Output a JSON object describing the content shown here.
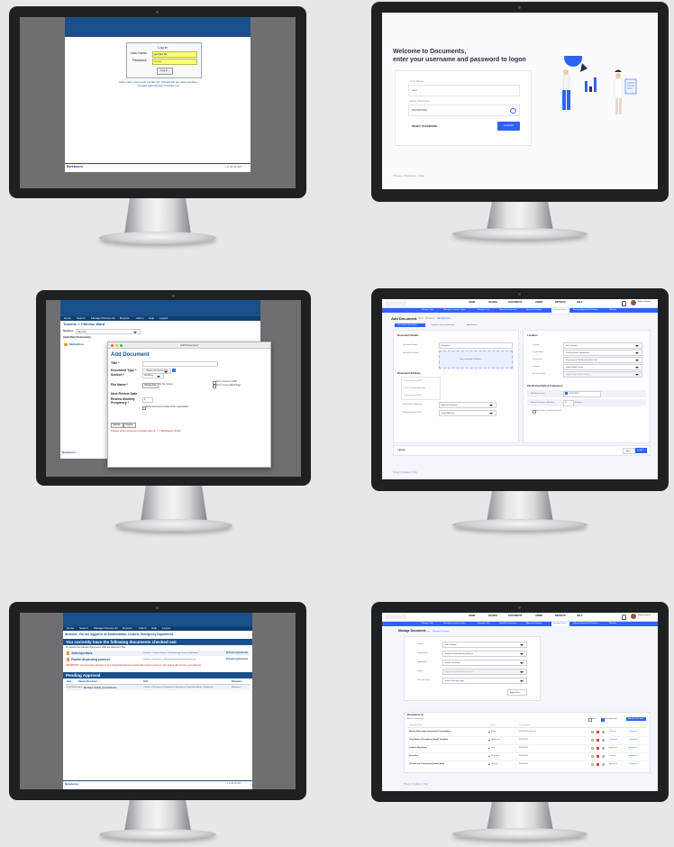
{
  "classic_login": {
    "heading": "Log in",
    "username_label": "User Name:",
    "username_value": "georgie.bb",
    "password_label": "Password:",
    "password_value": "••••••••",
    "login_button": "Log in",
    "hint": "Note: User name must contain '@'. Passwords are case sensitive. Contact administrator if locked out.",
    "footer_brand": "Barebones",
    "footer_right": "v 6.46.32.007"
  },
  "modern_login": {
    "welcome_line1": "Welcome to Documents,",
    "welcome_line2": "enter your username and password to logon",
    "username_label": "User Name",
    "username_value": "user",
    "password_label": "Enter Password",
    "password_value": "PASSWORD",
    "reset_button": "RESET PASSWORD",
    "logon_button": "LOGON",
    "footer": "Privacy | Disclaimer | Help"
  },
  "classic_add": {
    "nav": [
      "Home",
      "Search",
      "Manage Documents",
      "Reports",
      "Admin",
      "Help",
      "Logout"
    ],
    "breadcrumb": "Tumeric > Chinese Ward",
    "section_label": "Section:",
    "section_value": "Section",
    "add_new_label": "[Add New Document]",
    "list_item": "Medication",
    "dialog_title": "Add Document",
    "dialog_heading": "Add Document",
    "title_label": "Title *",
    "doctype_label": "Document Type *",
    "doctype_value": "-- Select document type --",
    "section_field_label": "Section *",
    "section_field_value": "Medicine",
    "file_label": "File Name *",
    "file_button": "Choose File",
    "file_status": "No file chosen",
    "convert_pdf": "Don't convert to PDF",
    "convert_word": "Don't convert Word Tags",
    "next_review_label": "Next Review Date",
    "review_freq_label": "Review Monthly Frequency *",
    "review_freq_value": "6",
    "private_label": "Make document private within organisation",
    "submit_button": "Submit",
    "cancel_button": "Cancel",
    "required_note": "Please enter document details above. * = Mandatory fields.",
    "footer_brand": "Barebones"
  },
  "modern_add": {
    "nav": [
      "HOME",
      "SEARCH",
      "DOCUMENTS",
      "ADMIN",
      "REPORTS",
      "HELP"
    ],
    "user_name": "Ashlyn Barnes",
    "subnav": [
      "Manage Tags",
      "Manage Document Types",
      "Manage Links",
      "Update Permissions",
      "Approval Settings",
      "Manage Roles",
      "Manage Approval Workflows",
      "Modules"
    ],
    "title": "Add Document",
    "breadcrumb": [
      "Home",
      "Document",
      "Add Document"
    ],
    "tabs": [
      "Document Information",
      "Supplementary Information",
      "Applications"
    ],
    "details_heading": "Document Details",
    "doc_name_label": "Document Name",
    "doc_name_value": "Example",
    "upload_label": "Upload Document",
    "drop_text": "Drag and drop or Browse",
    "settings_heading": "Document Settings",
    "settings_options": [
      "Don't convert to PDF",
      "Never Include Watermark",
      "Document is Private"
    ],
    "who_reviews_label": "Select Who to Approve",
    "who_reviews_value": "Approval Required",
    "approval_label": "Select Document Rule",
    "approval_value": "Single Approval",
    "location_heading": "Location",
    "location_fields": [
      {
        "label": "Country",
        "value": "New Zealand"
      },
      {
        "label": "Organisation",
        "value": "Primary Health Organisation"
      },
      {
        "label": "Department",
        "value": "Department of Health and Social Care"
      },
      {
        "label": "Location",
        "value": "Digital Health Centre"
      },
      {
        "label": "Document Type",
        "value": "Digital Health Health Clinical"
      }
    ],
    "review_heading": "Set Review Date & Frequency",
    "review_date_label": "Set Review Date",
    "review_date_value": "21/02/2023",
    "review_freq_label": "Review Frequency (Months)",
    "review_freq_value": "12",
    "review_freq_unit": "Monthly",
    "retain_label": "Don't Make Compulsory Read",
    "cancel_button": "CANCEL",
    "back_button": "BACK",
    "submit_button": "SUBMIT",
    "footer": "Privacy | Disclaimer | Help"
  },
  "classic_manage": {
    "nav": [
      "Home",
      "Search",
      "Manage Documents",
      "Reports",
      "Admin",
      "Help",
      "Logout"
    ],
    "welcome": "Welcome. You are logged in as Administrator, Lecturer, Emergency Department.",
    "checked_out_heading": "You currently have the following documents checked out:",
    "checked_out_intro": "To access the relevant documents click the document title.",
    "checked_out_items": [
      {
        "name": "Joint Injections",
        "location": "Lecturer > Chinese Ward > Chemotherapy Infusion Information",
        "action": "[Check-in] [Cancel]"
      },
      {
        "name": "Parallel dispensing protocol",
        "location": "Lecturer > Pharmacy > Drug Dispensing Infusions/protocols",
        "action": "[Check-in] [Cancel]"
      }
    ],
    "important_note": "IMPORTANT: You must save changes to your local draft documents during the check-in process. Just saving will not save your changes.",
    "pending_heading": "Pending Approval",
    "pending_columns": [
      "Date",
      "Review Document",
      "Path",
      "Reviewers"
    ],
    "pending_rows": [
      {
        "date": "21/02/2024 admin",
        "document": "Broken Ankle procedures",
        "path": "Lecturer > Emergency Department > Emergency Department Acute Orthopaedic",
        "reviewers": "Reference"
      }
    ],
    "footer_brand": "Barebones",
    "footer_right": "v 6.46.32.007"
  },
  "modern_manage": {
    "nav": [
      "HOME",
      "SEARCH",
      "DOCUMENTS",
      "ADMIN",
      "REPORTS",
      "HELP"
    ],
    "user_name": "Ashlyn Barnes",
    "subnav": [
      "Manage Tags",
      "Manage Document Types",
      "Manage Links",
      "Update Permissions",
      "Approval Settings",
      "Manage Roles",
      "Manage Approval Workflows",
      "Modules"
    ],
    "title": "Manage Document",
    "breadcrumb": [
      "Home",
      "Manage Document"
    ],
    "filters": [
      {
        "label": "Country",
        "value": "New Zealand"
      },
      {
        "label": "Organisation",
        "value": "Regional Health Authority Service"
      },
      {
        "label": "Department",
        "value": "Health and Safety"
      },
      {
        "label": "Group",
        "value": "Regional Health Authority Service"
      },
      {
        "label": "Document Type",
        "value": "Select Document Type"
      }
    ],
    "apply_button": "Apply Filters",
    "list_heading": "Document List",
    "list_subheading": "Active Documents",
    "list_controls": [
      "Filter",
      "Show Archived"
    ],
    "add_button": "Add New Document",
    "columns": [
      "Document Name",
      "Owner",
      "Last Updated"
    ],
    "rows": [
      {
        "name": "Advice (Secondary Inspection) Consultation",
        "owner": "Admin",
        "updated": "21/02/2023 Rejected",
        "status": "Rejected",
        "action": "Published"
      },
      {
        "name": "Food Safety (Compliance Audit) Template",
        "owner": "Healthcare",
        "updated": "21/02/2023",
        "status": "Published",
        "action": "Published"
      },
      {
        "name": "Incident Reporting",
        "owner": "Dept",
        "updated": "21/02/2023",
        "status": "Approved",
        "action": "Approved"
      },
      {
        "name": "Inventory",
        "owner": "Pharmacy",
        "updated": "21/02/2023",
        "status": "Pending",
        "action": "Approved"
      },
      {
        "name": "Clinical and Community Quality Audit",
        "owner": "Nursing",
        "updated": "21/02/2023",
        "status": "Approved",
        "action": "Published"
      }
    ],
    "footer": "Privacy | Disclaimer | Help"
  }
}
